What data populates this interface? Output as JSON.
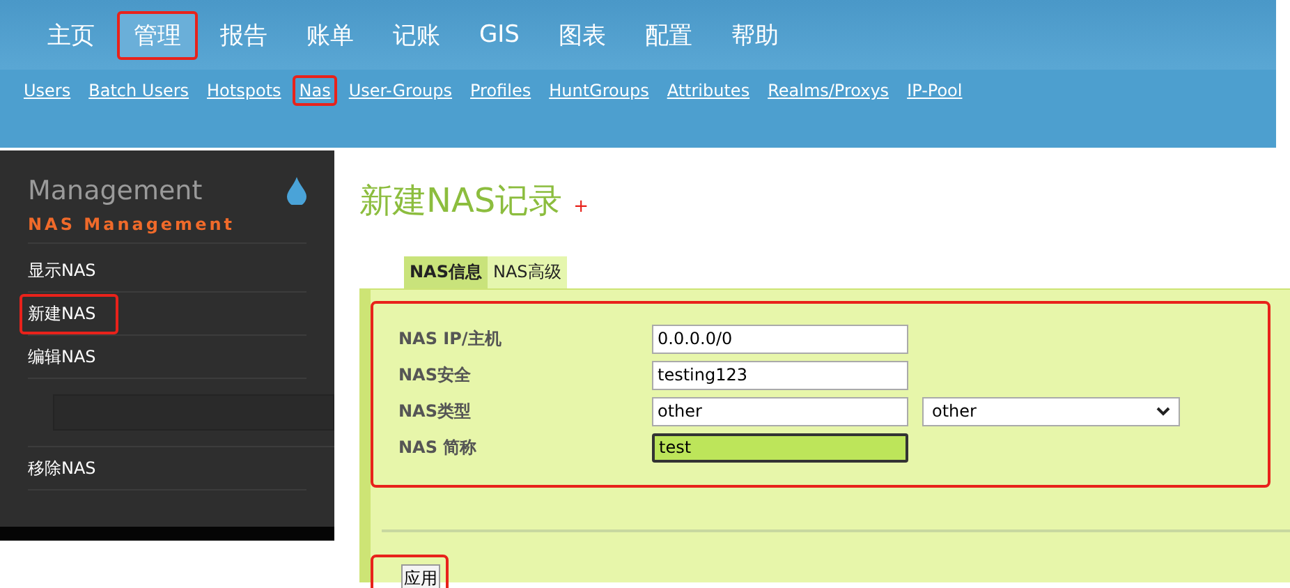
{
  "main_nav": [
    {
      "label": "主页",
      "selected": false,
      "highlighted": false
    },
    {
      "label": "管理",
      "selected": true,
      "highlighted": true
    },
    {
      "label": "报告",
      "selected": false,
      "highlighted": false
    },
    {
      "label": "账单",
      "selected": false,
      "highlighted": false
    },
    {
      "label": "记账",
      "selected": false,
      "highlighted": false
    },
    {
      "label": "GIS",
      "selected": false,
      "highlighted": false
    },
    {
      "label": "图表",
      "selected": false,
      "highlighted": false
    },
    {
      "label": "配置",
      "selected": false,
      "highlighted": false
    },
    {
      "label": "帮助",
      "selected": false,
      "highlighted": false
    }
  ],
  "sub_nav": [
    {
      "label": "Users",
      "highlighted": false
    },
    {
      "label": "Batch Users",
      "highlighted": false
    },
    {
      "label": "Hotspots",
      "highlighted": false
    },
    {
      "label": "Nas",
      "highlighted": true
    },
    {
      "label": "User-Groups",
      "highlighted": false
    },
    {
      "label": "Profiles",
      "highlighted": false
    },
    {
      "label": "HuntGroups",
      "highlighted": false
    },
    {
      "label": "Attributes",
      "highlighted": false
    },
    {
      "label": "Realms/Proxys",
      "highlighted": false
    },
    {
      "label": "IP-Pool",
      "highlighted": false
    }
  ],
  "sidebar": {
    "title": "Management",
    "subtitle": "NAS Management",
    "items": [
      {
        "kind": "link",
        "label": "显示NAS",
        "highlighted": false
      },
      {
        "kind": "link",
        "label": "新建NAS",
        "highlighted": true
      },
      {
        "kind": "link",
        "label": "编辑NAS",
        "highlighted": false
      },
      {
        "kind": "input"
      },
      {
        "kind": "link",
        "label": "移除NAS",
        "highlighted": false
      }
    ]
  },
  "page_title": "新建NAS记录",
  "title_mark": "+",
  "tabs": [
    {
      "label": "NAS信息",
      "selected": true
    },
    {
      "label": "NAS高级",
      "selected": false
    }
  ],
  "form": {
    "highlighted": true,
    "fields": [
      {
        "kind": "text",
        "label": "NAS IP/主机",
        "value": "0.0.0.0/0",
        "focused": false
      },
      {
        "kind": "text",
        "label": "NAS安全",
        "value": "testing123",
        "focused": false
      },
      {
        "kind": "text_select",
        "label": "NAS类型",
        "value": "other",
        "option": "other",
        "focused": false
      },
      {
        "kind": "text",
        "label": "NAS 简称",
        "value": "test",
        "focused": true
      }
    ]
  },
  "apply_button": {
    "label": "应用",
    "highlighted": true
  }
}
